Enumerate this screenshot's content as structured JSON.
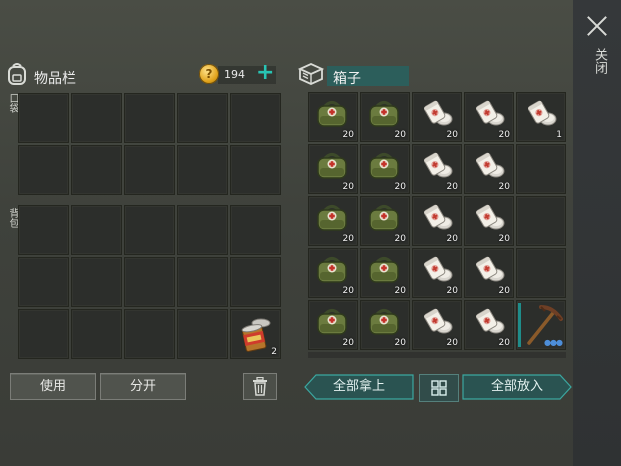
{
  "inventory": {
    "title": "物品栏",
    "coins": "194",
    "pocket_label": "口袋",
    "backpack_label": "背包",
    "pocket_slots": [
      null,
      null,
      null,
      null,
      null,
      null,
      null,
      null,
      null,
      null
    ],
    "backpack_slots": [
      null,
      null,
      null,
      null,
      null,
      null,
      null,
      null,
      null,
      null,
      null,
      null,
      null,
      null,
      {
        "item": "canned-food",
        "count": "2"
      }
    ]
  },
  "box": {
    "title": "箱子",
    "slots": [
      {
        "item": "medical-bag",
        "count": "20"
      },
      {
        "item": "medical-bag",
        "count": "20"
      },
      {
        "item": "bandage-pills",
        "count": "20"
      },
      {
        "item": "bandage-pills",
        "count": "20"
      },
      {
        "item": "bandage-pills",
        "count": "1"
      },
      {
        "item": "medical-bag",
        "count": "20"
      },
      {
        "item": "medical-bag",
        "count": "20"
      },
      {
        "item": "bandage-pills",
        "count": "20"
      },
      {
        "item": "bandage-pills",
        "count": "20"
      },
      null,
      {
        "item": "medical-bag",
        "count": "20"
      },
      {
        "item": "medical-bag",
        "count": "20"
      },
      {
        "item": "bandage-pills",
        "count": "20"
      },
      {
        "item": "bandage-pills",
        "count": "20"
      },
      null,
      {
        "item": "medical-bag",
        "count": "20"
      },
      {
        "item": "medical-bag",
        "count": "20"
      },
      {
        "item": "bandage-pills",
        "count": "20"
      },
      {
        "item": "bandage-pills",
        "count": "20"
      },
      null,
      {
        "item": "medical-bag",
        "count": "20"
      },
      {
        "item": "medical-bag",
        "count": "20"
      },
      {
        "item": "bandage-pills",
        "count": "20"
      },
      {
        "item": "bandage-pills",
        "count": "20"
      },
      {
        "item": "pickaxe",
        "count": ""
      }
    ]
  },
  "buttons": {
    "use": "使用",
    "split": "分开",
    "take_all": "全部拿上",
    "put_all": "全部放入",
    "close": "关闭"
  },
  "colors": {
    "accent": "#28c4b4",
    "box_title": "#2c5e5b",
    "coin": "#e0a21b"
  }
}
